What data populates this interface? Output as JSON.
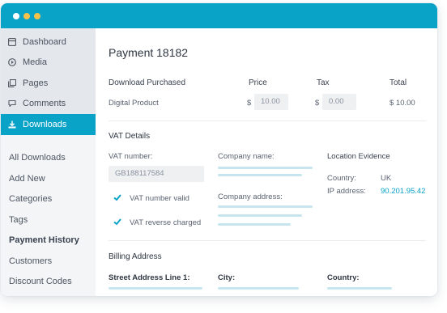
{
  "colors": {
    "accent": "#0aa3c8",
    "sidebar_bg": "#f3f5f7"
  },
  "window": {
    "dots": [
      {
        "color": "#ffffff"
      },
      {
        "color": "#f7c24a"
      },
      {
        "color": "#f7c24a"
      }
    ]
  },
  "sidebar": {
    "menu": [
      {
        "label": "Dashboard",
        "icon": "dashboard-icon"
      },
      {
        "label": "Media",
        "icon": "media-icon"
      },
      {
        "label": "Pages",
        "icon": "pages-icon"
      },
      {
        "label": "Comments",
        "icon": "comments-icon"
      },
      {
        "label": "Downloads",
        "icon": "download-icon",
        "active": true
      }
    ],
    "submenu": [
      "All Downloads",
      "Add New",
      "Categories",
      "Tags",
      "Payment History",
      "Customers",
      "Discount Codes"
    ]
  },
  "payment": {
    "title": "Payment 18182",
    "headers": {
      "item": "Download Purchased",
      "price": "Price",
      "tax": "Tax",
      "total": "Total"
    },
    "row": {
      "item": "Digital Product",
      "currency": "$",
      "price": "10.00",
      "tax": "0.00",
      "total": "$ 10.00"
    }
  },
  "vat": {
    "section": "VAT Details",
    "vat_number_label": "VAT number:",
    "vat_number": "GB188117584",
    "company_name_label": "Company name:",
    "company_address_label": "Company address:",
    "location_label": "Location Evidence",
    "country_label": "Country:",
    "country": "UK",
    "ip_label": "IP address:",
    "ip": "90.201.95.42",
    "valid_label": "VAT number valid",
    "reverse_label": "VAT reverse charged"
  },
  "billing": {
    "section": "Billing Address",
    "street_label": "Street Address Line 1:",
    "city_label": "City:",
    "country_label": "Country:"
  }
}
